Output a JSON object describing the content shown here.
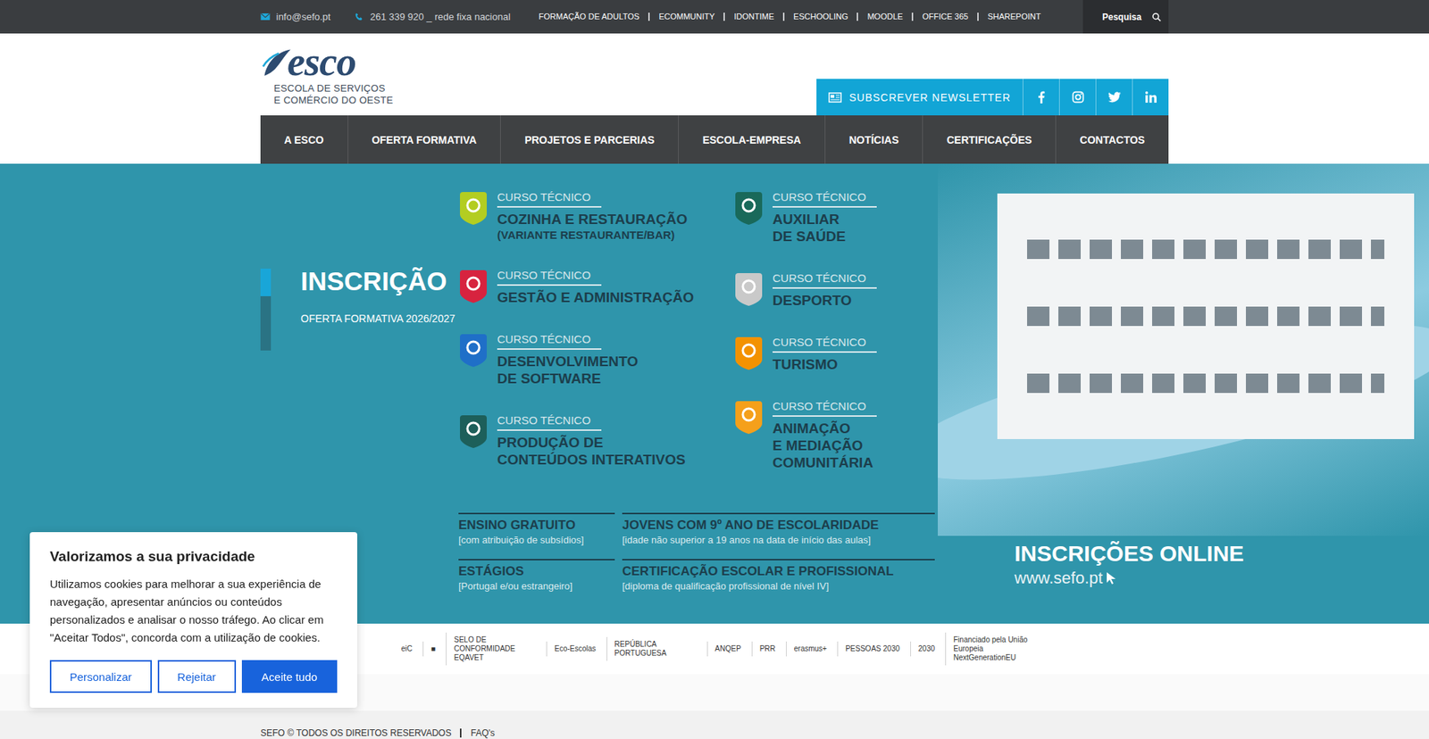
{
  "topbar": {
    "email": "info@sefo.pt",
    "phone": "261 339 920 _ rede fixa nacional",
    "links": [
      "FORMAÇÃO DE ADULTOS",
      "ECOMMUNITY",
      "IDONTIME",
      "ESCHOOLING",
      "MOODLE",
      "OFFICE 365",
      "SHAREPOINT"
    ],
    "search": {
      "placeholder": "Pesquisa"
    }
  },
  "header": {
    "logo": {
      "word": "esco",
      "subtitle": [
        "ESCOLA DE SERVIÇOS",
        "E COMÉRCIO DO OESTE"
      ]
    },
    "newsletter": "SUBSCREVER NEWSLETTER"
  },
  "nav": [
    "A ESCO",
    "OFERTA FORMATIVA",
    "PROJETOS E PARCERIAS",
    "ESCOLA-EMPRESA",
    "NOTÍCIAS",
    "CERTIFICAÇÕES",
    "CONTACTOS"
  ],
  "hero": {
    "slides": [
      {
        "selected": true
      },
      {
        "selected": false
      }
    ],
    "caption": {
      "title": "INSCRIÇÃO",
      "subtitle": "OFERTA FORMATIVA 2026/2027"
    },
    "banner": {
      "columns": [
        [
          {
            "label": "CURSO TÉCNICO",
            "lines": [
              "COZINHA E RESTAURAÇÃO",
              "(VARIANTE RESTAURANTE/BAR)"
            ],
            "color": "#b3cd21"
          },
          {
            "label": "CURSO TÉCNICO",
            "lines": [
              "GESTÃO E ADMINISTRAÇÃO"
            ],
            "color": "#d7233f"
          },
          {
            "label": "CURSO TÉCNICO",
            "lines": [
              "DESENVOLVIMENTO",
              "DE SOFTWARE"
            ],
            "color": "#1f6fc8"
          },
          {
            "label": "CURSO TÉCNICO",
            "lines": [
              "PRODUÇÃO DE",
              "CONTEÚDOS INTERATIVOS"
            ],
            "color": "#1d5f5a"
          }
        ],
        [
          {
            "label": "CURSO TÉCNICO",
            "lines": [
              "AUXILIAR",
              "DE SAÚDE"
            ],
            "color": "#19695a"
          },
          {
            "label": "CURSO TÉCNICO",
            "lines": [
              "DESPORTO"
            ],
            "color": "#c9c9c9"
          },
          {
            "label": "CURSO TÉCNICO",
            "lines": [
              "TURISMO"
            ],
            "color": "#f39200"
          },
          {
            "label": "CURSO TÉCNICO",
            "lines": [
              "ANIMAÇÃO",
              "E MEDIAÇÃO",
              "COMUNITÁRIA"
            ],
            "color": "#f5a01b"
          }
        ]
      ],
      "notes": [
        {
          "title": "ENSINO GRATUITO",
          "detail": "[com atribuição de subsídios]"
        },
        {
          "title": "JOVENS COM 9º ANO DE ESCOLARIDADE",
          "detail": "[idade não superior a 19 anos na data de início das aulas]"
        },
        {
          "title": "ESTÁGIOS",
          "detail": "[Portugal e/ou estrangeiro]"
        },
        {
          "title": "CERTIFICAÇÃO ESCOLAR E PROFISSIONAL",
          "detail": "[diploma de qualificação profissional de nível IV]"
        }
      ],
      "online": {
        "title": "INSCRIÇÕES ONLINE",
        "url": "www.sefo.pt"
      }
    }
  },
  "partners": [
    "eiC",
    "■",
    "SELO DE CONFORMIDADE EQAVET",
    "Eco-Escolas",
    "REPÚBLICA PORTUGUESA",
    "ANQEP",
    "PRR",
    "erasmus+",
    "PESSOAS 2030",
    "2030",
    "Financiado pela União Europeia NextGenerationEU"
  ],
  "footer": {
    "copyright": "SEFO © TODOS OS DIREITOS RESERVADOS",
    "links": [
      "FAQ's"
    ]
  },
  "cookie": {
    "title": "Valorizamos a sua privacidade",
    "text": "Utilizamos cookies para melhorar a sua experiência de navegação, apresentar anúncios ou conteúdos personalizados e analisar o nosso tráfego. Ao clicar em \"Aceitar Todos\", concorda com a utilização de cookies.",
    "buttons": [
      {
        "label": "Personalizar",
        "primary": false
      },
      {
        "label": "Rejeitar",
        "primary": false
      },
      {
        "label": "Aceite tudo",
        "primary": true
      }
    ]
  }
}
